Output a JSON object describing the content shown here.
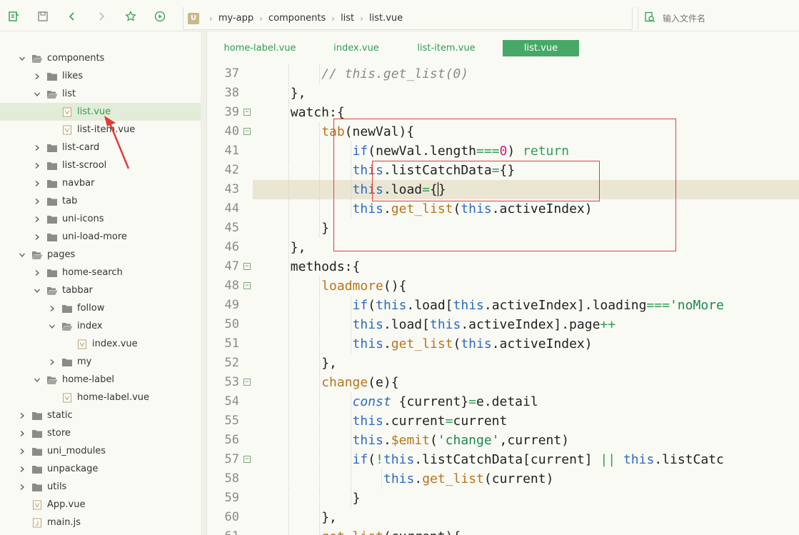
{
  "breadcrumb": [
    "my-app",
    "components",
    "list",
    "list.vue"
  ],
  "search": {
    "placeholder": "输入文件名"
  },
  "tree": [
    {
      "label": "components",
      "depth": 1,
      "type": "folder",
      "state": "open"
    },
    {
      "label": "likes",
      "depth": 2,
      "type": "folder",
      "state": "closed"
    },
    {
      "label": "list",
      "depth": 2,
      "type": "folder",
      "state": "open"
    },
    {
      "label": "list.vue",
      "depth": 3,
      "type": "vue",
      "selected": true
    },
    {
      "label": "list-item.vue",
      "depth": 3,
      "type": "vue"
    },
    {
      "label": "list-card",
      "depth": 2,
      "type": "folder",
      "state": "closed"
    },
    {
      "label": "list-scrool",
      "depth": 2,
      "type": "folder",
      "state": "closed"
    },
    {
      "label": "navbar",
      "depth": 2,
      "type": "folder",
      "state": "closed"
    },
    {
      "label": "tab",
      "depth": 2,
      "type": "folder",
      "state": "closed"
    },
    {
      "label": "uni-icons",
      "depth": 2,
      "type": "folder",
      "state": "closed"
    },
    {
      "label": "uni-load-more",
      "depth": 2,
      "type": "folder",
      "state": "closed"
    },
    {
      "label": "pages",
      "depth": 1,
      "type": "folder",
      "state": "open"
    },
    {
      "label": "home-search",
      "depth": 2,
      "type": "folder",
      "state": "closed"
    },
    {
      "label": "tabbar",
      "depth": 2,
      "type": "folder",
      "state": "open"
    },
    {
      "label": "follow",
      "depth": 3,
      "type": "folder",
      "state": "closed"
    },
    {
      "label": "index",
      "depth": 3,
      "type": "folder",
      "state": "open"
    },
    {
      "label": "index.vue",
      "depth": 4,
      "type": "vue"
    },
    {
      "label": "my",
      "depth": 3,
      "type": "folder",
      "state": "closed"
    },
    {
      "label": "home-label",
      "depth": 2,
      "type": "folder",
      "state": "open"
    },
    {
      "label": "home-label.vue",
      "depth": 3,
      "type": "vue"
    },
    {
      "label": "static",
      "depth": 1,
      "type": "folder",
      "state": "closed"
    },
    {
      "label": "store",
      "depth": 1,
      "type": "folder",
      "state": "closed"
    },
    {
      "label": "uni_modules",
      "depth": 1,
      "type": "folder",
      "state": "closed"
    },
    {
      "label": "unpackage",
      "depth": 1,
      "type": "folder",
      "state": "closed"
    },
    {
      "label": "utils",
      "depth": 1,
      "type": "folder",
      "state": "closed"
    },
    {
      "label": "App.vue",
      "depth": 1,
      "type": "vue"
    },
    {
      "label": "main.js",
      "depth": 1,
      "type": "js"
    }
  ],
  "tabs": [
    {
      "label": "home-label.vue",
      "active": false
    },
    {
      "label": "index.vue",
      "active": false
    },
    {
      "label": "list-item.vue",
      "active": false
    },
    {
      "label": "list.vue",
      "active": true
    }
  ],
  "editor": {
    "current_line": 43,
    "lines": [
      {
        "n": "37",
        "indent": 3,
        "fold": false,
        "tokens": [
          [
            "c-comment",
            "// this.get_list(0)"
          ]
        ]
      },
      {
        "n": "38",
        "indent": 2,
        "fold": false,
        "tokens": [
          [
            "",
            "},"
          ]
        ]
      },
      {
        "n": "39",
        "indent": 2,
        "fold": true,
        "tokens": [
          [
            "",
            "watch:{"
          ]
        ]
      },
      {
        "n": "40",
        "indent": 3,
        "fold": true,
        "tokens": [
          [
            "c-fn",
            "tab"
          ],
          [
            "",
            "(newVal){"
          ]
        ]
      },
      {
        "n": "41",
        "indent": 4,
        "fold": false,
        "tokens": [
          [
            "c-kw",
            "if"
          ],
          [
            "",
            "(newVal.length"
          ],
          [
            "c-op",
            "==="
          ],
          [
            "c-num",
            "0"
          ],
          [
            "",
            ") "
          ],
          [
            "c-op",
            "return"
          ]
        ]
      },
      {
        "n": "42",
        "indent": 4,
        "fold": false,
        "tokens": [
          [
            "c-kw",
            "this"
          ],
          [
            "",
            ".listCatchData"
          ],
          [
            "c-op",
            "="
          ],
          [
            "",
            "{}"
          ]
        ]
      },
      {
        "n": "43",
        "indent": 4,
        "fold": false,
        "tokens": [
          [
            "c-kw",
            "this"
          ],
          [
            "",
            ".load"
          ],
          [
            "c-op",
            "="
          ],
          [
            "",
            "{"
          ],
          [
            "caret",
            ""
          ],
          [
            "",
            "}"
          ]
        ]
      },
      {
        "n": "44",
        "indent": 4,
        "fold": false,
        "tokens": [
          [
            "c-kw",
            "this"
          ],
          [
            "",
            "."
          ],
          [
            "c-fn",
            "get_list"
          ],
          [
            "",
            "("
          ],
          [
            "c-kw",
            "this"
          ],
          [
            "",
            ".activeIndex)"
          ]
        ]
      },
      {
        "n": "45",
        "indent": 3,
        "fold": false,
        "tokens": [
          [
            "",
            "}"
          ]
        ]
      },
      {
        "n": "46",
        "indent": 2,
        "fold": false,
        "tokens": [
          [
            "",
            "},"
          ]
        ]
      },
      {
        "n": "47",
        "indent": 2,
        "fold": true,
        "tokens": [
          [
            "",
            "methods:{"
          ]
        ]
      },
      {
        "n": "48",
        "indent": 3,
        "fold": true,
        "tokens": [
          [
            "c-fn",
            "loadmore"
          ],
          [
            "",
            "(){"
          ]
        ]
      },
      {
        "n": "49",
        "indent": 4,
        "fold": false,
        "tokens": [
          [
            "c-kw",
            "if"
          ],
          [
            "",
            "("
          ],
          [
            "c-kw",
            "this"
          ],
          [
            "",
            ".load["
          ],
          [
            "c-kw",
            "this"
          ],
          [
            "",
            ".activeIndex].loading"
          ],
          [
            "c-op",
            "==="
          ],
          [
            "c-str",
            "'noMore"
          ]
        ]
      },
      {
        "n": "50",
        "indent": 4,
        "fold": false,
        "tokens": [
          [
            "c-kw",
            "this"
          ],
          [
            "",
            ".load["
          ],
          [
            "c-kw",
            "this"
          ],
          [
            "",
            ".activeIndex].page"
          ],
          [
            "c-op",
            "++"
          ]
        ]
      },
      {
        "n": "51",
        "indent": 4,
        "fold": false,
        "tokens": [
          [
            "c-kw",
            "this"
          ],
          [
            "",
            "."
          ],
          [
            "c-fn",
            "get_list"
          ],
          [
            "",
            "("
          ],
          [
            "c-kw",
            "this"
          ],
          [
            "",
            ".activeIndex)"
          ]
        ]
      },
      {
        "n": "52",
        "indent": 3,
        "fold": false,
        "tokens": [
          [
            "",
            "},"
          ]
        ]
      },
      {
        "n": "53",
        "indent": 3,
        "fold": true,
        "tokens": [
          [
            "c-fn",
            "change"
          ],
          [
            "",
            "(e){"
          ]
        ]
      },
      {
        "n": "54",
        "indent": 4,
        "fold": false,
        "tokens": [
          [
            "c-kw-it",
            "const"
          ],
          [
            "",
            " {current}"
          ],
          [
            "c-op",
            "="
          ],
          [
            "",
            "e.detail"
          ]
        ]
      },
      {
        "n": "55",
        "indent": 4,
        "fold": false,
        "tokens": [
          [
            "c-kw",
            "this"
          ],
          [
            "",
            ".current"
          ],
          [
            "c-op",
            "="
          ],
          [
            "",
            "current"
          ]
        ]
      },
      {
        "n": "56",
        "indent": 4,
        "fold": false,
        "tokens": [
          [
            "c-kw",
            "this"
          ],
          [
            "",
            "."
          ],
          [
            "c-fn",
            "$emit"
          ],
          [
            "",
            "("
          ],
          [
            "c-str",
            "'change'"
          ],
          [
            "",
            ",current)"
          ]
        ]
      },
      {
        "n": "57",
        "indent": 4,
        "fold": true,
        "tokens": [
          [
            "c-kw",
            "if"
          ],
          [
            "",
            "("
          ],
          [
            "c-op",
            "!"
          ],
          [
            "c-kw",
            "this"
          ],
          [
            "",
            ".listCatchData[current] "
          ],
          [
            "c-op",
            "||"
          ],
          [
            "",
            " "
          ],
          [
            "c-kw",
            "this"
          ],
          [
            "",
            ".listCatc"
          ]
        ]
      },
      {
        "n": "58",
        "indent": 5,
        "fold": false,
        "tokens": [
          [
            "c-kw",
            "this"
          ],
          [
            "",
            "."
          ],
          [
            "c-fn",
            "get_list"
          ],
          [
            "",
            "(current)"
          ]
        ]
      },
      {
        "n": "59",
        "indent": 4,
        "fold": false,
        "tokens": [
          [
            "",
            "}"
          ]
        ]
      },
      {
        "n": "60",
        "indent": 3,
        "fold": false,
        "tokens": [
          [
            "",
            "},"
          ]
        ]
      },
      {
        "n": "61",
        "indent": 3,
        "fold": false,
        "tokens": [
          [
            "c-fn",
            "get_list"
          ],
          [
            "",
            "(current){"
          ]
        ]
      }
    ]
  },
  "colors": {
    "accent": "#2e9e4f",
    "tab_active": "#48a868",
    "annotation": "#e23b3b",
    "current_line": "#ebe6d4"
  }
}
